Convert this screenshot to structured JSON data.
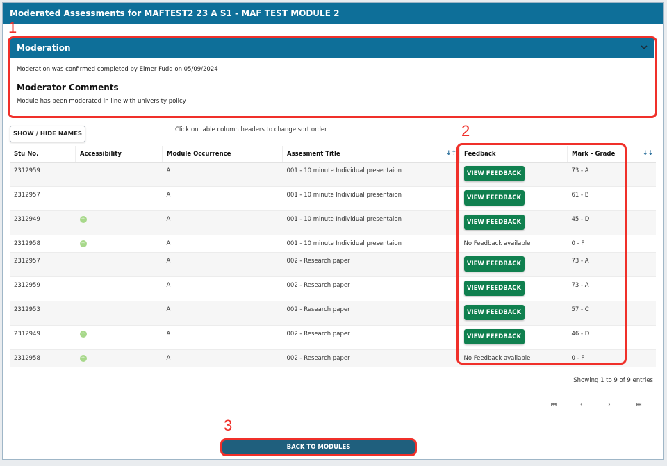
{
  "header": {
    "title": "Moderated Assessments for MAFTEST2 23 A S1 - MAF TEST MODULE 2"
  },
  "annotations": {
    "one": "1",
    "two": "2",
    "three": "3"
  },
  "moderation": {
    "title": "Moderation",
    "confirmation": "Moderation was confirmed completed by Elmer Fudd on 05/09/2024",
    "comments_heading": "Moderator Comments",
    "comments": "Module has been moderated in line with university policy",
    "collapse_icon": "chevron-down-icon"
  },
  "toolbar": {
    "show_hide_label": "SHOW / HIDE NAMES",
    "sort_hint": "Click on table column headers to change sort order"
  },
  "table": {
    "columns": [
      "Stu No.",
      "Accessibility",
      "Module Occurrence",
      "Assesment Title",
      "Feedback",
      "Mark - Grade"
    ],
    "view_feedback_label": "VIEW FEEDBACK",
    "no_feedback_label": "No Feedback available",
    "rows": [
      {
        "stu_no": "2312959",
        "accessibility": false,
        "occurrence": "A",
        "title": "001 - 10 minute Individual presentaion",
        "has_feedback": true,
        "mark": "73 - A"
      },
      {
        "stu_no": "2312957",
        "accessibility": false,
        "occurrence": "A",
        "title": "001 - 10 minute Individual presentaion",
        "has_feedback": true,
        "mark": "61 - B"
      },
      {
        "stu_no": "2312949",
        "accessibility": true,
        "occurrence": "A",
        "title": "001 - 10 minute Individual presentaion",
        "has_feedback": true,
        "mark": "45 - D"
      },
      {
        "stu_no": "2312958",
        "accessibility": true,
        "occurrence": "A",
        "title": "001 - 10 minute Individual presentaion",
        "has_feedback": false,
        "mark": "0 - F"
      },
      {
        "stu_no": "2312957",
        "accessibility": false,
        "occurrence": "A",
        "title": "002 - Research paper",
        "has_feedback": true,
        "mark": "73 - A"
      },
      {
        "stu_no": "2312959",
        "accessibility": false,
        "occurrence": "A",
        "title": "002 - Research paper",
        "has_feedback": true,
        "mark": "73 - A"
      },
      {
        "stu_no": "2312953",
        "accessibility": false,
        "occurrence": "A",
        "title": "002 - Research paper",
        "has_feedback": true,
        "mark": "57 - C"
      },
      {
        "stu_no": "2312949",
        "accessibility": true,
        "occurrence": "A",
        "title": "002 - Research paper",
        "has_feedback": true,
        "mark": "46 - D"
      },
      {
        "stu_no": "2312958",
        "accessibility": true,
        "occurrence": "A",
        "title": "002 - Research paper",
        "has_feedback": false,
        "mark": "0 - F"
      }
    ]
  },
  "pagination": {
    "summary": "Showing 1 to 9 of 9 entries",
    "first": "⏮",
    "prev": "‹",
    "next": "›",
    "last": "⏭"
  },
  "footer": {
    "back_label": "BACK TO MODULES"
  },
  "colors": {
    "header": "#0e6f99",
    "feedback_button": "#10804f",
    "back_button": "#1f5f7d",
    "annotation": "#f0302a",
    "accessibility": "#a7d88a"
  }
}
